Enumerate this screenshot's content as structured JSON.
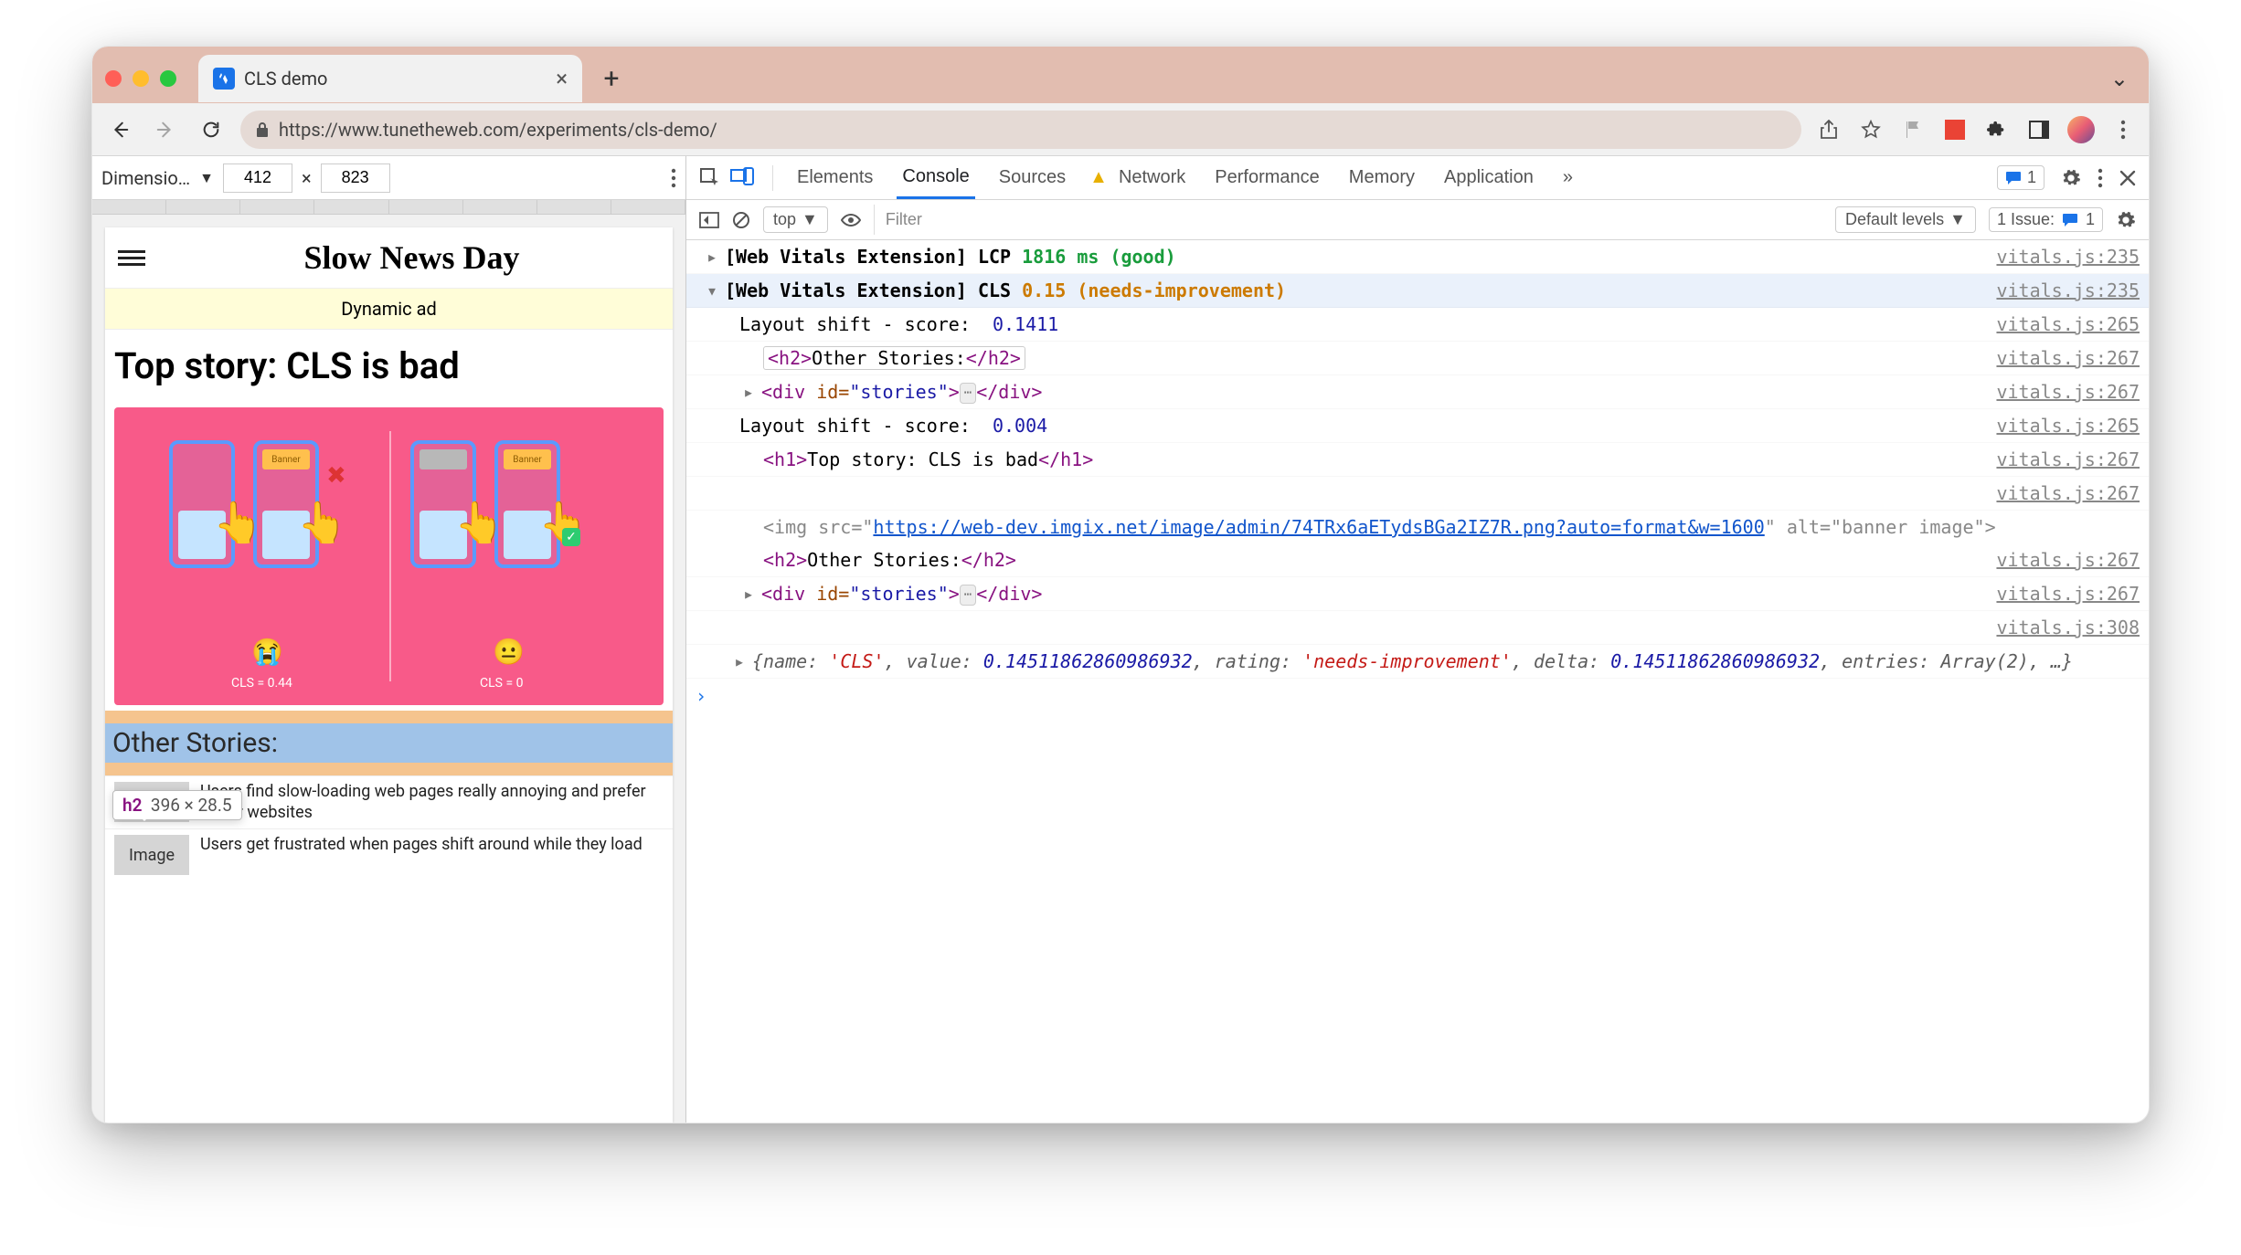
{
  "browser": {
    "tab_title": "CLS demo",
    "url_display": "https://www.tunetheweb.com/experiments/cls-demo/",
    "new_tab_label": "+",
    "close_tab": "×",
    "chevron": "⌄"
  },
  "device_toolbar": {
    "dimensions_label": "Dimensio…",
    "width": "412",
    "height": "823",
    "separator": "×"
  },
  "page": {
    "site_title": "Slow News Day",
    "dynamic_ad": "Dynamic ad",
    "top_story": "Top story: CLS is bad",
    "hero_left_caption": "CLS = 0.44",
    "hero_right_caption": "CLS = 0",
    "banner_label": "Banner",
    "emoji_left": "😭",
    "emoji_right": "😐",
    "other_stories_heading": "Other Stories:",
    "tooltip_tag": "h2",
    "tooltip_dims": "396 × 28.5",
    "thumb_label": "Image",
    "stories": [
      "Users find slow-loading web pages really annoying and prefer faster websites",
      "Users get frustrated when pages shift around while they load"
    ]
  },
  "devtools": {
    "tabs": {
      "elements": "Elements",
      "console": "Console",
      "sources": "Sources",
      "network": "Network",
      "performance": "Performance",
      "memory": "Memory",
      "application": "Application",
      "more": "»"
    },
    "messages_count": "1",
    "consolebar": {
      "context": "top",
      "filter_placeholder": "Filter",
      "levels": "Default levels",
      "issue_label": "1 Issue:",
      "issue_count": "1"
    },
    "log": {
      "lcp_prefix": "[Web Vitals Extension] LCP ",
      "lcp_value": "1816 ms (good)",
      "cls_prefix": "[Web Vitals Extension] CLS ",
      "cls_value": "0.15 (needs-improvement)",
      "shift1_label": "Layout shift - score:  ",
      "shift1_val": "0.1411",
      "h2_pill": "Other Stories:",
      "div_stories_prefix": "▸",
      "div_stories_id": "stories",
      "shift2_label": "Layout shift - score:  ",
      "shift2_val": "0.004",
      "h1_text": "Top story: CLS is bad",
      "img_src": "https://web-dev.imgix.net/image/admin/74TRx6aETydsBGa2IZ7R.png?auto=format&w=1600",
      "img_alt_frag": "banner image",
      "obj_dump": "{name: 'CLS', value: 0.14511862860986932, rating: 'needs-improvement', delta: 0.14511862860986932, entries: Array(2), …}",
      "src_235": "vitals.js:235",
      "src_265": "vitals.js:265",
      "src_267": "vitals.js:267",
      "src_308": "vitals.js:308",
      "prompt": "›"
    }
  }
}
